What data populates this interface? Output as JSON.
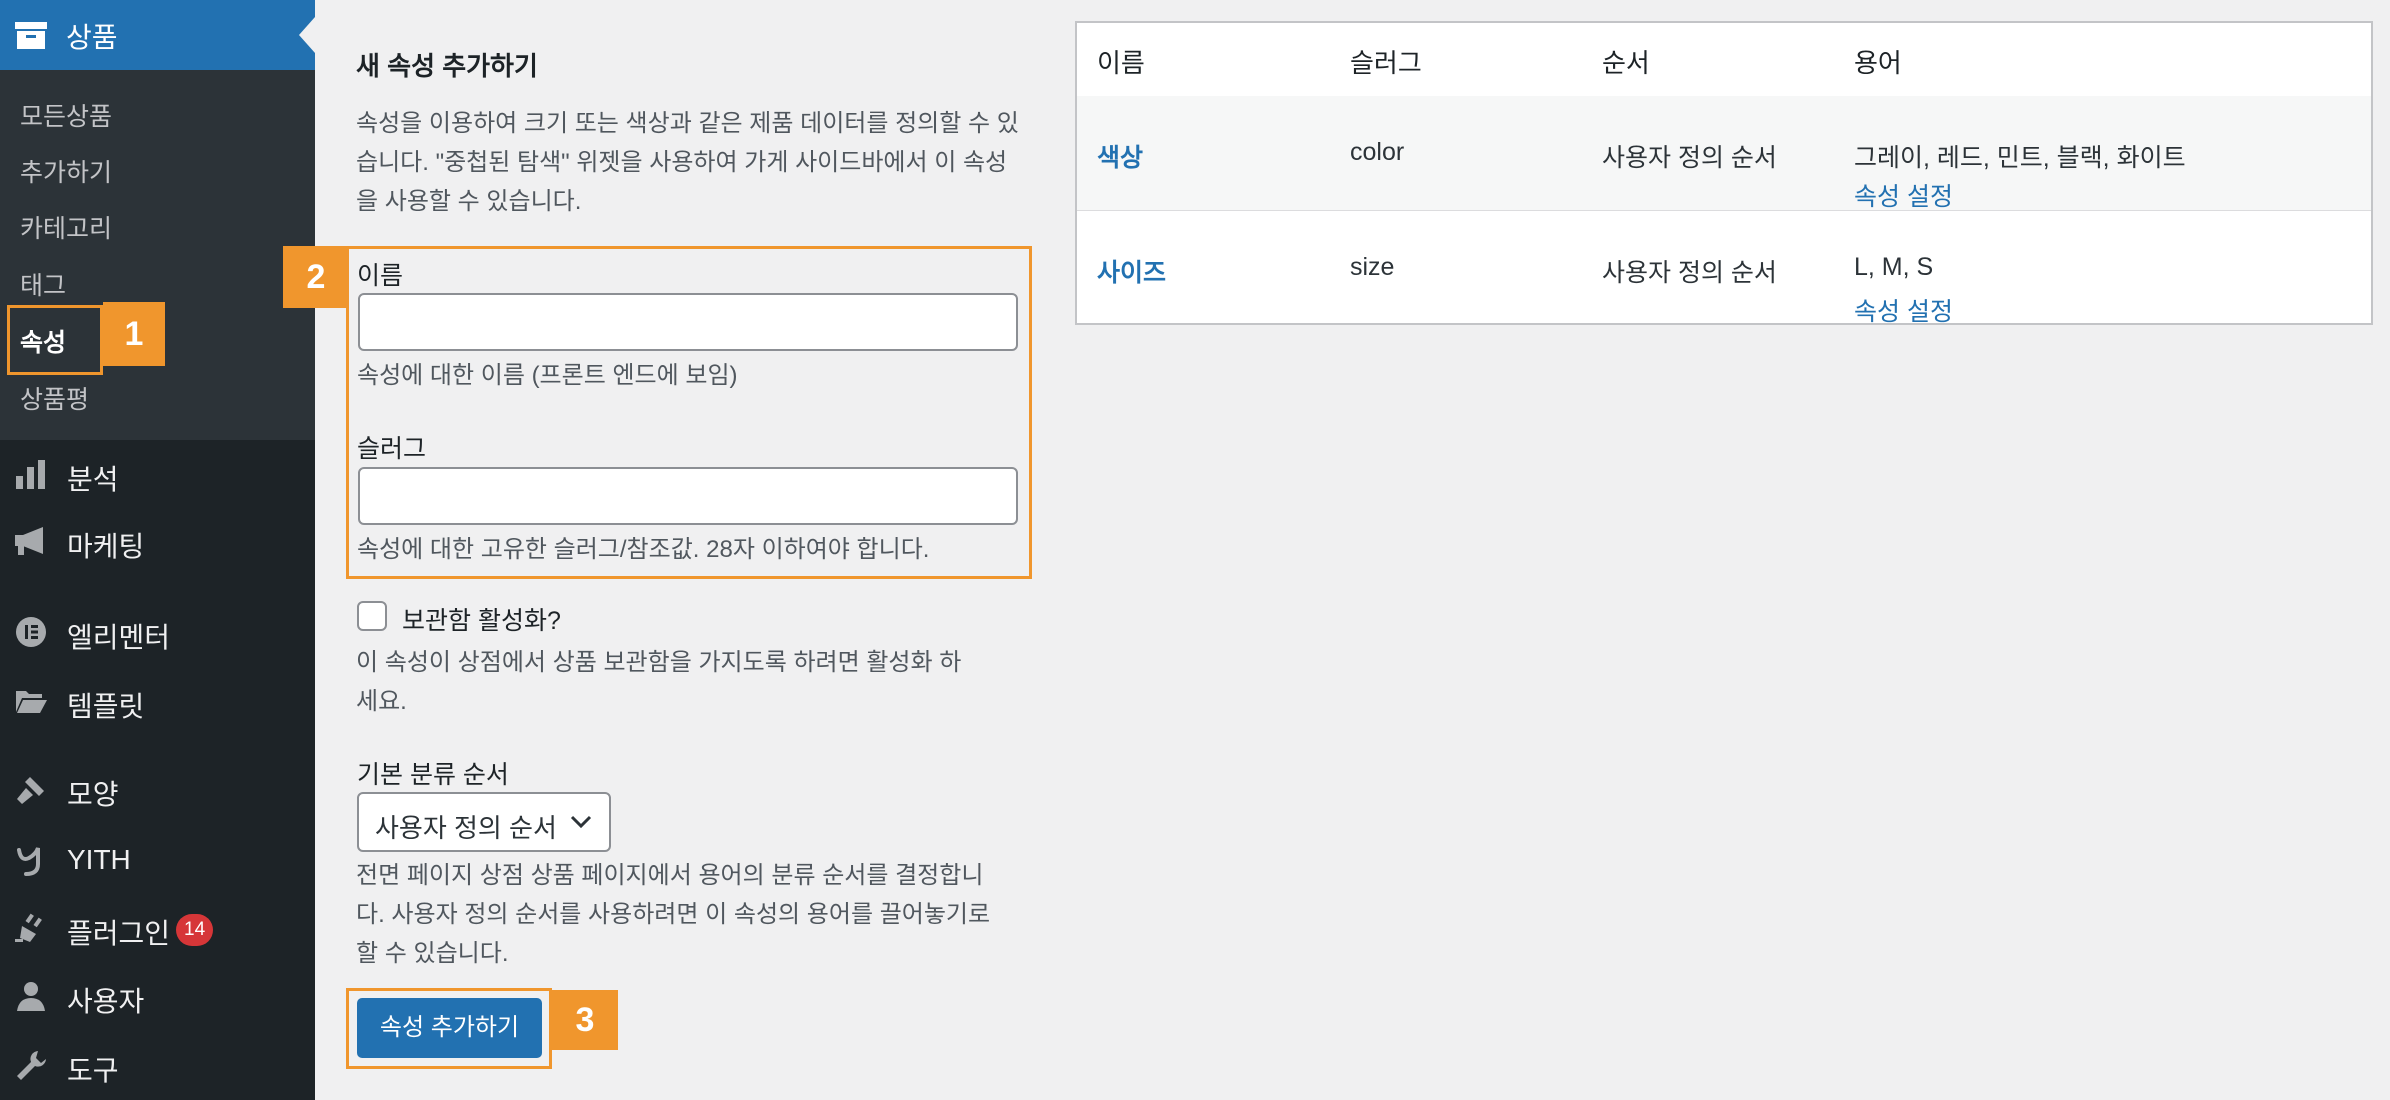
{
  "sidebar": {
    "top_item": {
      "label": "상품",
      "icon": "archive-icon"
    },
    "submenu": [
      {
        "label": "모든상품"
      },
      {
        "label": "추가하기"
      },
      {
        "label": "카테고리"
      },
      {
        "label": "태그"
      },
      {
        "label": "속성",
        "current": true
      },
      {
        "label": "상품평"
      }
    ],
    "menu": [
      {
        "label": "분석",
        "icon": "bar-chart-icon"
      },
      {
        "label": "마케팅",
        "icon": "megaphone-icon"
      },
      {
        "label": "엘리멘터",
        "icon": "elementor-icon"
      },
      {
        "label": "템플릿",
        "icon": "folder-open-icon"
      },
      {
        "label": "모양",
        "icon": "paintbrush-icon"
      },
      {
        "label": "YITH",
        "icon": "yith-icon"
      },
      {
        "label": "플러그인",
        "icon": "plugin-icon",
        "badge": "14"
      },
      {
        "label": "사용자",
        "icon": "user-icon"
      },
      {
        "label": "도구",
        "icon": "wrench-icon"
      }
    ]
  },
  "form": {
    "title": "새 속성 추가하기",
    "intro": [
      "속성을 이용하여 크기 또는 색상과 같은 제품 데이터를 정의할 수 있",
      "습니다. \"중첩된 탐색\" 위젯을 사용하여 가게 사이드바에서 이 속성",
      "을 사용할 수 있습니다."
    ],
    "name_label": "이름",
    "name_value": "",
    "name_help": "속성에 대한 이름 (프론트 엔드에 보임)",
    "slug_label": "슬러그",
    "slug_value": "",
    "slug_help": "속성에 대한 고유한 슬러그/참조값. 28자 이하여야 합니다.",
    "archive_label": "보관함 활성화?",
    "archive_help": [
      "이 속성이 상점에서 상품 보관함을 가지도록 하려면 활성화 하",
      "세요."
    ],
    "sort_label": "기본 분류 순서",
    "sort_value": "사용자 정의 순서",
    "sort_help": [
      "전면 페이지 상점 상품 페이지에서 용어의 분류 순서를 결정합니",
      "다. 사용자 정의 순서를 사용하려면 이 속성의 용어를 끌어놓기로",
      "할 수 있습니다."
    ],
    "submit_label": "속성 추가하기"
  },
  "callouts": [
    "1",
    "2",
    "3"
  ],
  "table": {
    "headers": [
      "이름",
      "슬러그",
      "순서",
      "용어"
    ],
    "rows": [
      {
        "name": "색상",
        "slug": "color",
        "order": "사용자 정의 순서",
        "terms": "그레이, 레드, 민트, 블랙, 화이트",
        "action": "속성 설정"
      },
      {
        "name": "사이즈",
        "slug": "size",
        "order": "사용자 정의 순서",
        "terms": "L, M, S",
        "action": "속성 설정"
      }
    ]
  },
  "colors": {
    "sidebar_bg": "#1d2327",
    "submenu_bg": "#2c3338",
    "accent": "#2271b1",
    "highlight": "#f0962d",
    "badge": "#d63638"
  }
}
